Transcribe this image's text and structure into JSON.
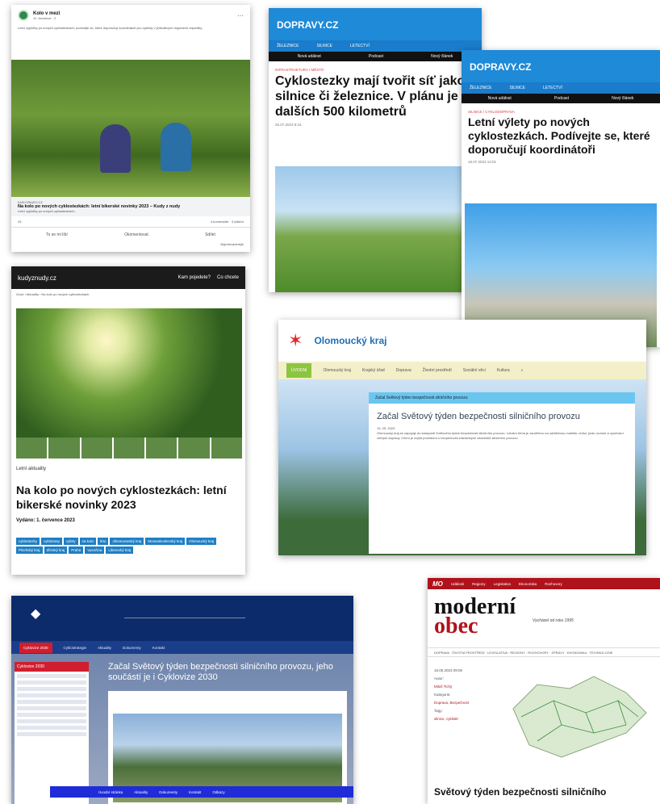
{
  "facebook": {
    "page_name": "Kolo v mezi",
    "page_meta": "11. července · 2",
    "body": "Letní vyjížďky po nových cyklostezkách: podívejte se, které doporučují koordinátoři pro cyklisty v jednotlivých regionech republiky.",
    "link_cat": "KUDYZNUDY.CZ",
    "link_title": "Na kolo po nových cyklostezkách: letní bikerské novinky 2023 – Kudy z nudy",
    "link_desc": "Letní vyjížďky po nových cyklostezkách...",
    "reactions": "25",
    "stats": "4 komentáře · 3 sdílení",
    "act_like": "To se mi líbí",
    "act_comment": "Okomentovat",
    "act_share": "Sdílet",
    "more": "Nejrelevantnější"
  },
  "doprava1": {
    "logo": "DOPRAVY.CZ",
    "nav": [
      "ŽELEZNICE",
      "SILNICE",
      "LETECTVÍ"
    ],
    "bar": [
      "Nová událost",
      "Podcast",
      "Nový článek"
    ],
    "cat": "INFRASTRUKTURA / MĚSTO",
    "title": "Cyklostezky mají tvořit síť jako silnice či železnice. V plánu je dalších 500 kilometrů",
    "date": "25.07.2023 9:15"
  },
  "doprava2": {
    "logo": "DOPRAVY.CZ",
    "nav": [
      "ŽELEZNICE",
      "SILNICE",
      "LETECTVÍ"
    ],
    "bar": [
      "Nová událost",
      "Podcast",
      "Nový článek"
    ],
    "cat": "SILNICE / CYKLODOPRAVA",
    "title": "Letní výlety po nových cyklostezkách. Podívejte se, které doporučují koordinátoři",
    "date": "18.07.2023 12:01"
  },
  "kudy": {
    "logo": "kudyznudy.cz",
    "link1": "Kam pojedete?",
    "link2": "Co chcete",
    "crumb": "Úvod › Aktuality › Na kolo po nových cyklostezkách",
    "label": "Letní aktuality",
    "title": "Na kolo po nových cyklostezkách: letní bikerské novinky 2023",
    "date": "Vydáno: 1. července 2023",
    "tags": [
      "cyklostezky",
      "cyklotrasy",
      "výlety",
      "na kolo",
      "léto",
      "Jihomoravský kraj",
      "Moravskoslezský kraj",
      "Olomoucký kraj",
      "Plzeňský kraj",
      "Zlínský kraj",
      "Praha",
      "Vysočina",
      "Liberecký kraj"
    ]
  },
  "olomoucky": {
    "brand": "Olomoucký kraj",
    "nav": [
      "ÚVODNÍ",
      "Olomoucký kraj",
      "Krajský úřad",
      "Doprava",
      "Životní prostředí",
      "Sociální věci",
      "Kultura"
    ],
    "crumb": "Začal Světový týden bezpečnosti silničního provozu",
    "title": "Začal Světový týden bezpečnosti silničního provozu",
    "date": "15. 05. 2023",
    "text": "Olomoucký kraj se zapojuje do kampaně Světového týdne bezpečnosti silničního provozu. Letošní téma je zaměřeno na udržitelnou mobilitu, chůzi, jízdu na kole a využívání veřejné dopravy. Cílem je zvýšit povědomí o bezpečnosti zranitelných účastníků silničního provozu."
  },
  "cyklovize": {
    "nav": [
      "Cyklovize 2030",
      "Cyklostrategie",
      "Aktuality",
      "Dokumenty",
      "Kontakt"
    ],
    "side_title": "Cyklovize 2030",
    "title": "Začal Světový týden bezpečnosti silničního provozu, jeho součástí je i Cyklovize 2030",
    "bluebar": [
      "Úvodní stránka",
      "Aktuality",
      "Dokumenty",
      "Kontakt",
      "Odkazy"
    ]
  },
  "moderni_obec": {
    "topbar": [
      "MO",
      "Události",
      "Regiony",
      "Legislativa",
      "Ekonomika",
      "Rozhovory"
    ],
    "title1": "moderní",
    "title2": "obec",
    "sub": "Vycházel od roku 1995",
    "nav": "DOPRAVA · ŽIVOTNÍ PROSTŘEDÍ · LEGISLATIVA · REGIONY · ROZHOVORY · ZPRÁVY · EKONOMIKA · TECHNOLOGIE",
    "date": "15.05.2023 09:05",
    "author_label": "Autor:",
    "author": "Miloš Tichý",
    "cat_label": "Kategorie:",
    "cat": "Doprava, Bezpečnost",
    "tags_label": "Tagy:",
    "tags": "silnice, cyklisté",
    "headline": "Světový týden bezpečnosti silničního"
  },
  "colors": {
    "fb_green": "#2f8a4b",
    "doprava_blue": "#1e8ad8",
    "kudy_tag": "#1f7fc4",
    "ol_green": "#8cc540",
    "cv_navy": "#0c2b6b",
    "mo_red": "#b0121b"
  }
}
